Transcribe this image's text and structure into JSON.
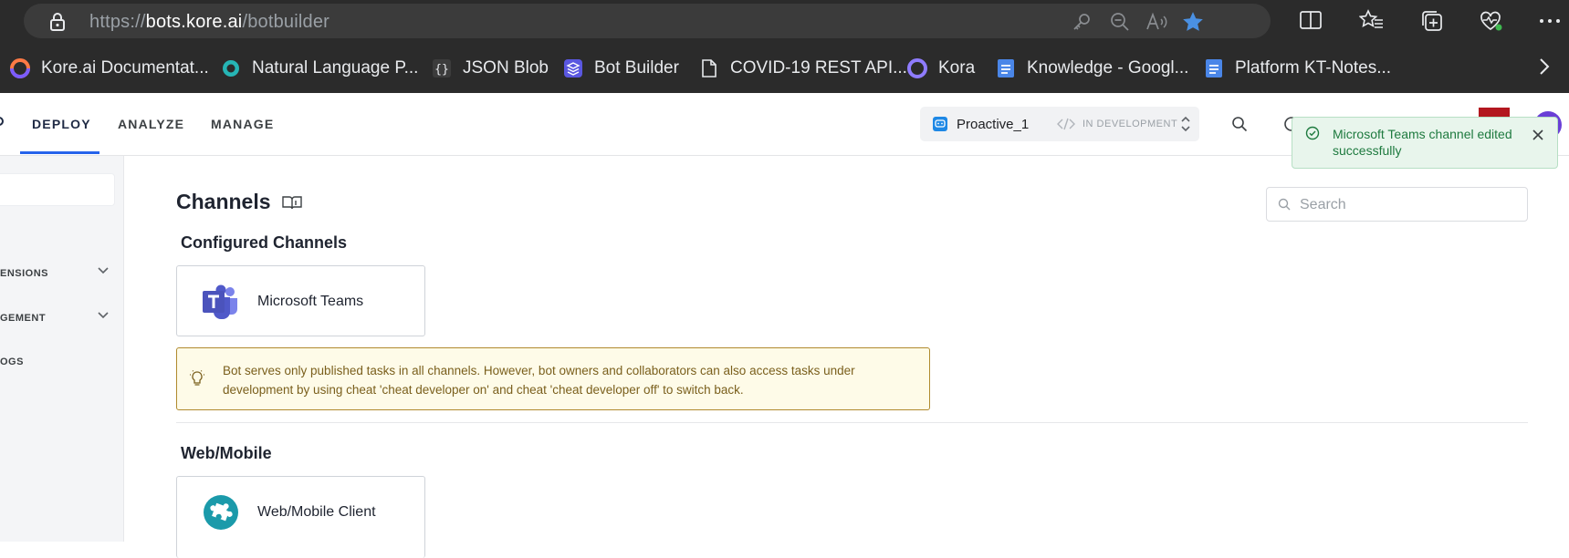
{
  "browser": {
    "url_prefix": "https://",
    "url_host": "bots.kore.ai",
    "url_path": "/botbuilder",
    "address_icons": [
      "key-icon",
      "zoom-out-icon",
      "read-aloud-icon",
      "favorite-star-icon"
    ],
    "toolbar_icons": [
      "split-screen-icon",
      "favorites-icon",
      "collections-icon",
      "browser-essentials-icon",
      "more-icon"
    ],
    "bookmarks": [
      {
        "label": "Kore.ai Documentat...",
        "icon": "kore-docs-icon"
      },
      {
        "label": "Natural Language P...",
        "icon": "nlp-icon"
      },
      {
        "label": "JSON Blob",
        "icon": "json-blob-icon"
      },
      {
        "label": "Bot Builder",
        "icon": "bot-builder-icon"
      },
      {
        "label": "COVID-19 REST API...",
        "icon": "page-icon"
      },
      {
        "label": "Kora",
        "icon": "kora-icon"
      },
      {
        "label": "Knowledge - Googl...",
        "icon": "google-docs-icon"
      },
      {
        "label": "Platform KT-Notes...",
        "icon": "google-docs-icon"
      }
    ],
    "accent_color": "#4a90e2"
  },
  "header": {
    "nav": [
      {
        "label": "DEPLOY",
        "active": true
      },
      {
        "label": "ANALYZE",
        "active": false
      },
      {
        "label": "MANAGE",
        "active": false
      }
    ],
    "bot_name": "Proactive_1",
    "bot_status": "IN DEVELOPMENT",
    "active_tab_color": "#2563eb"
  },
  "toast": {
    "message": "Microsoft Teams channel edited successfully",
    "type": "success"
  },
  "sidebar": {
    "items": [
      {
        "label": "ENSIONS",
        "expandable": true
      },
      {
        "label": "GEMENT",
        "expandable": true
      },
      {
        "label": "OGS",
        "expandable": false
      }
    ]
  },
  "main": {
    "title": "Channels",
    "search_placeholder": "Search",
    "configured_section": "Configured Channels",
    "configured_channels": [
      {
        "label": "Microsoft Teams",
        "icon": "microsoft-teams-icon"
      }
    ],
    "info_message": "Bot serves only published tasks in all channels. However, bot owners and collaborators can also access tasks under development by using cheat 'cheat developer on' and cheat 'cheat developer off' to switch back.",
    "web_section": "Web/Mobile",
    "web_channels": [
      {
        "label": "Web/Mobile Client",
        "icon": "web-mobile-client-icon"
      }
    ]
  }
}
